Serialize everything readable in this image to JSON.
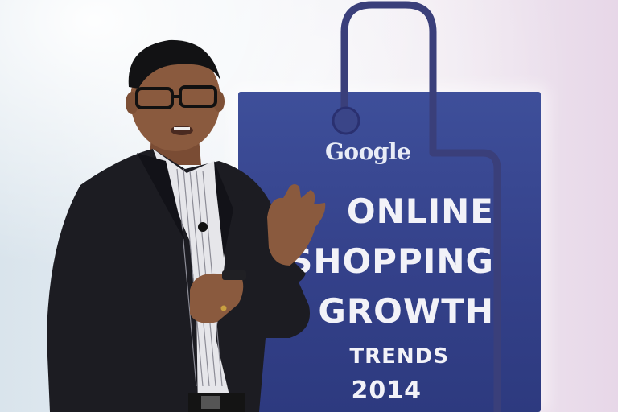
{
  "photo": {
    "subject": "presenter",
    "banner": {
      "brand": "Google",
      "lines": [
        "ONLINE",
        "SHOPPING",
        "GROWTH",
        "TRENDS",
        "2014"
      ]
    },
    "colors": {
      "banner": "#34418a",
      "suit": "#1c1c22",
      "skin": "#8a5a3e",
      "background": "#e9eef4"
    }
  }
}
